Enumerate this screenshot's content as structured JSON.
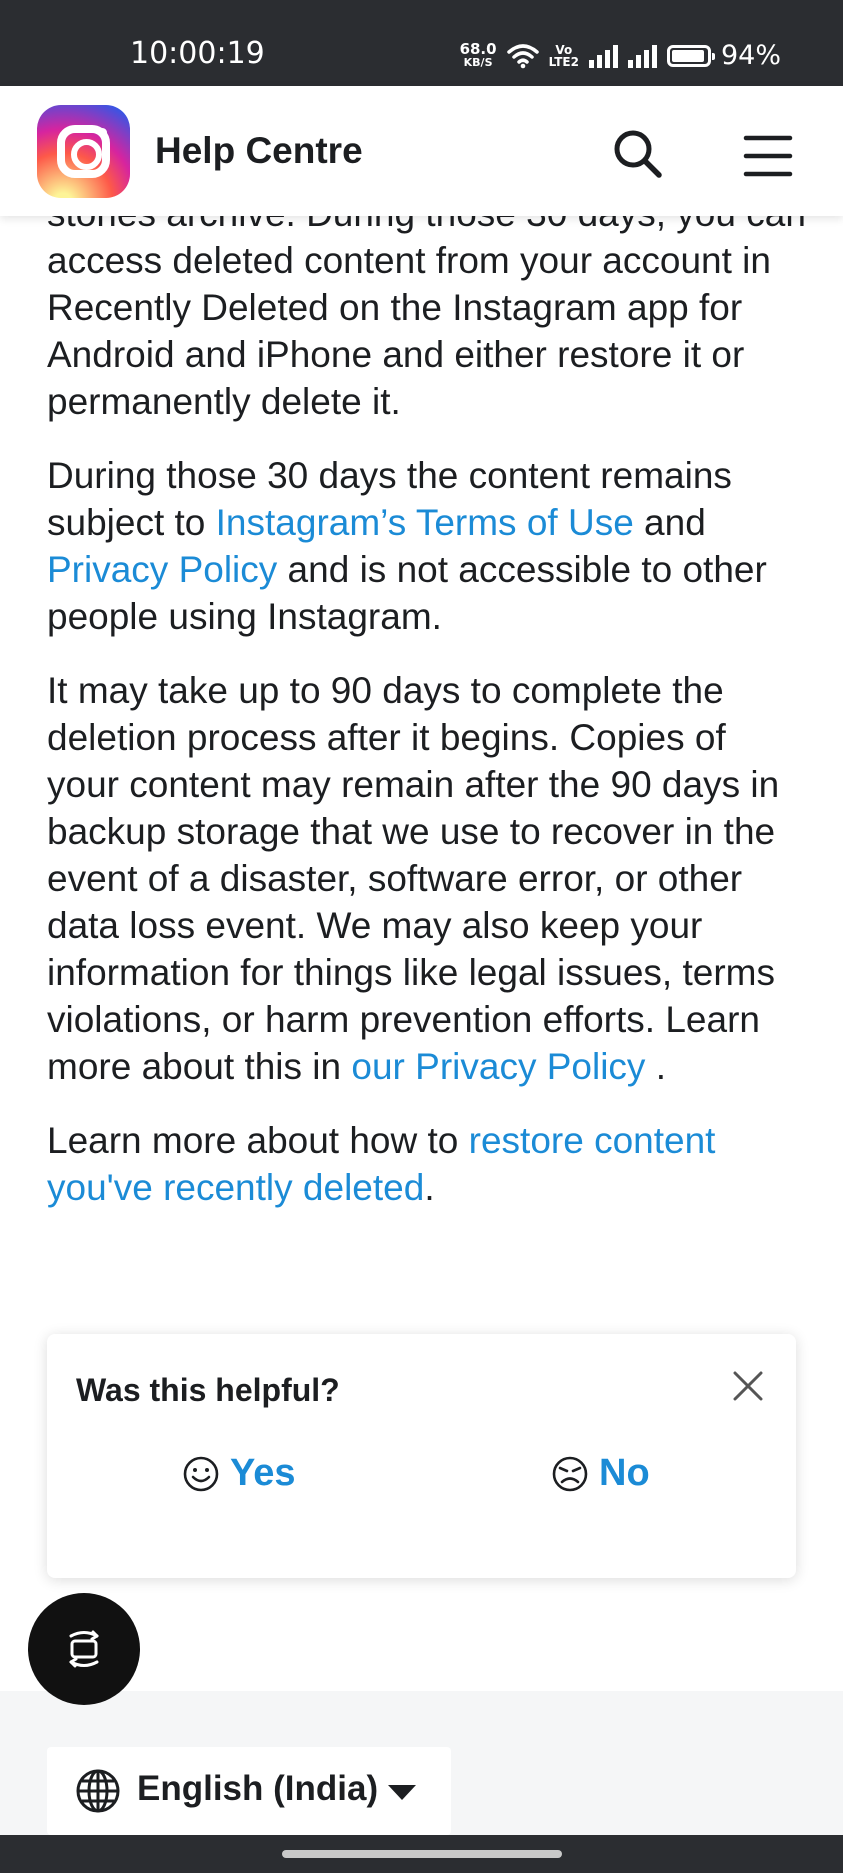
{
  "status_bar": {
    "time": "10:00:19",
    "net_speed_value": "68.0",
    "net_speed_unit": "KB/S",
    "volte_top": "Vo",
    "volte_bottom": "LTE2",
    "battery_level": 0.94,
    "battery_percent": "94%"
  },
  "header": {
    "title": "Help Centre",
    "brand_colors": [
      "#fdf497",
      "#fd5949",
      "#d6249f",
      "#285AEB"
    ]
  },
  "article": {
    "paragraph_1": "stories archive. During those 30 days, you can access deleted content from your account in Recently Deleted on the Instagram app for Android and iPhone and either restore it or permanently delete it.",
    "paragraph_2": {
      "text_1": "During those 30 days the content remains subject to ",
      "link_terms": "Instagram’s Terms of Use",
      "text_2": " and ",
      "link_privacy": "Privacy Policy",
      "text_3": " and is not accessible to other people using Instagram."
    },
    "paragraph_3": {
      "text_1": "It may take up to 90 days to complete the deletion process after it begins. Copies of your content may remain after the 90 days in backup storage that we use to recover in the event of a disaster, software error, or other data loss event. We may also keep your information for things like legal issues, terms violations, or harm prevention efforts. Learn more about this in ",
      "link_privacy": "our Privacy Policy",
      "text_2": " ."
    },
    "paragraph_4": {
      "text_1": "Learn more about how to ",
      "link_restore": "restore content you've recently deleted",
      "text_2": "."
    },
    "link_color": "#1b8bd6"
  },
  "feedback": {
    "title": "Was this helpful?",
    "yes_label": "Yes",
    "no_label": "No"
  },
  "footer": {
    "language": "English (India)"
  }
}
